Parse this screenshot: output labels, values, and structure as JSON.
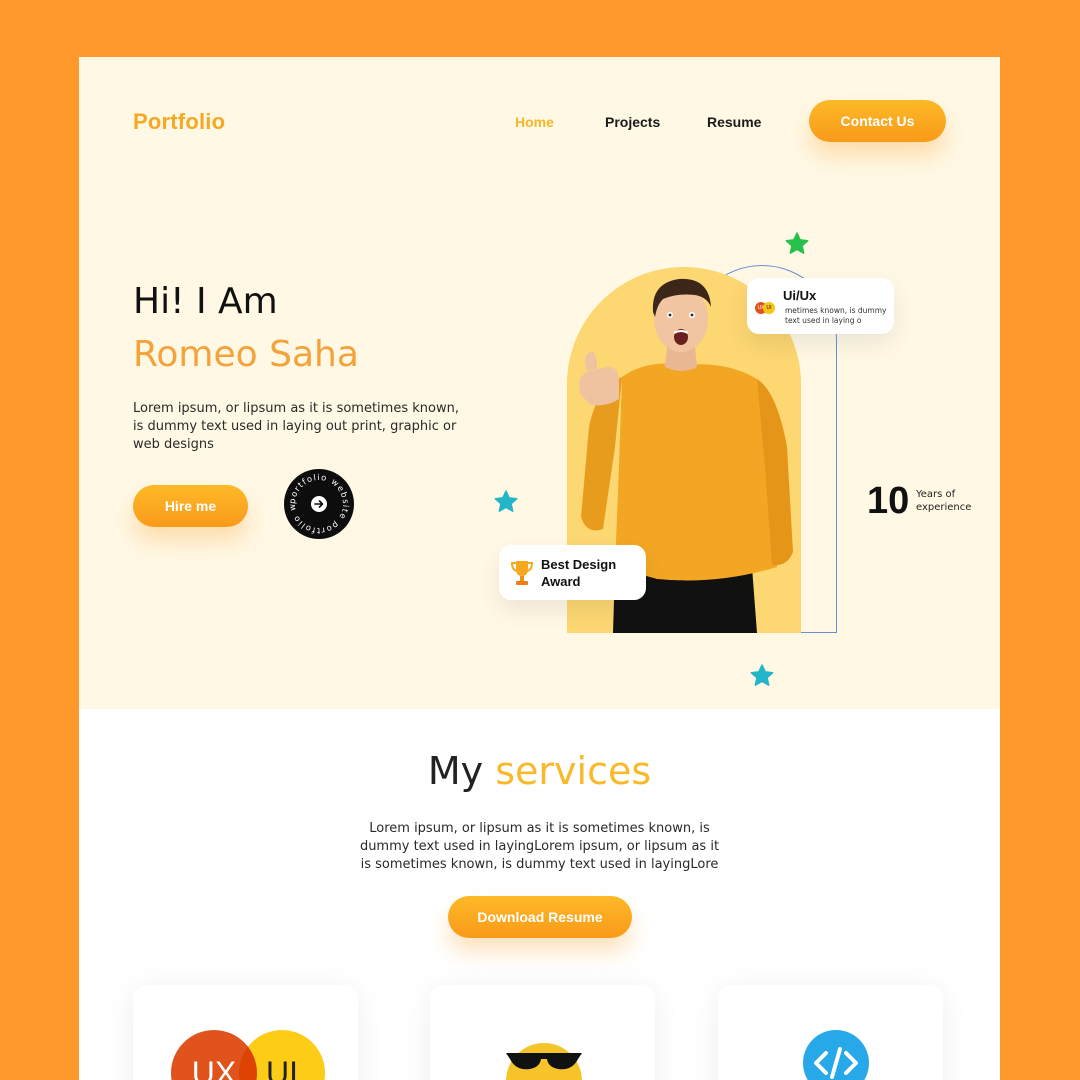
{
  "nav": {
    "logo": "Portfolio",
    "links": [
      "Home",
      "Projects",
      "Resume"
    ],
    "active": "Home",
    "contact_label": "Contact Us"
  },
  "hero": {
    "greeting": "Hi! I Am",
    "name": "Romeo Saha",
    "intro": "Lorem ipsum, or lipsum as it is sometimes known, is dummy text used in laying out print, graphic or web designs",
    "hire_label": "Hire me",
    "circle_badge_text": "portfolio website portfolio website",
    "uiux_card": {
      "title": "Ui/Ux",
      "desc": "metimes known, is dummy text used in laying o",
      "icon_ux": "UX",
      "icon_ui": "UI"
    },
    "award_card": {
      "text": "Best Design Award"
    },
    "experience": {
      "number": "10",
      "label": "Years of experience"
    }
  },
  "services": {
    "title_plain": "My",
    "title_accent": "services",
    "description": "Lorem ipsum, or lipsum as it is sometimes known, is dummy text used in layingLorem ipsum, or lipsum as it is sometimes known, is dummy text used in layingLore",
    "download_label": "Download Resume",
    "cards": [
      {
        "icon": "ux-ui-circles-icon",
        "ux": "UX",
        "ui": "UI"
      },
      {
        "icon": "sunglasses-emoji-icon"
      },
      {
        "icon": "code-icon"
      }
    ]
  },
  "colors": {
    "frame": "#ff982b",
    "accent": "#f9b929",
    "hero_bg": "#fff8e5",
    "arch": "#fcd772"
  }
}
